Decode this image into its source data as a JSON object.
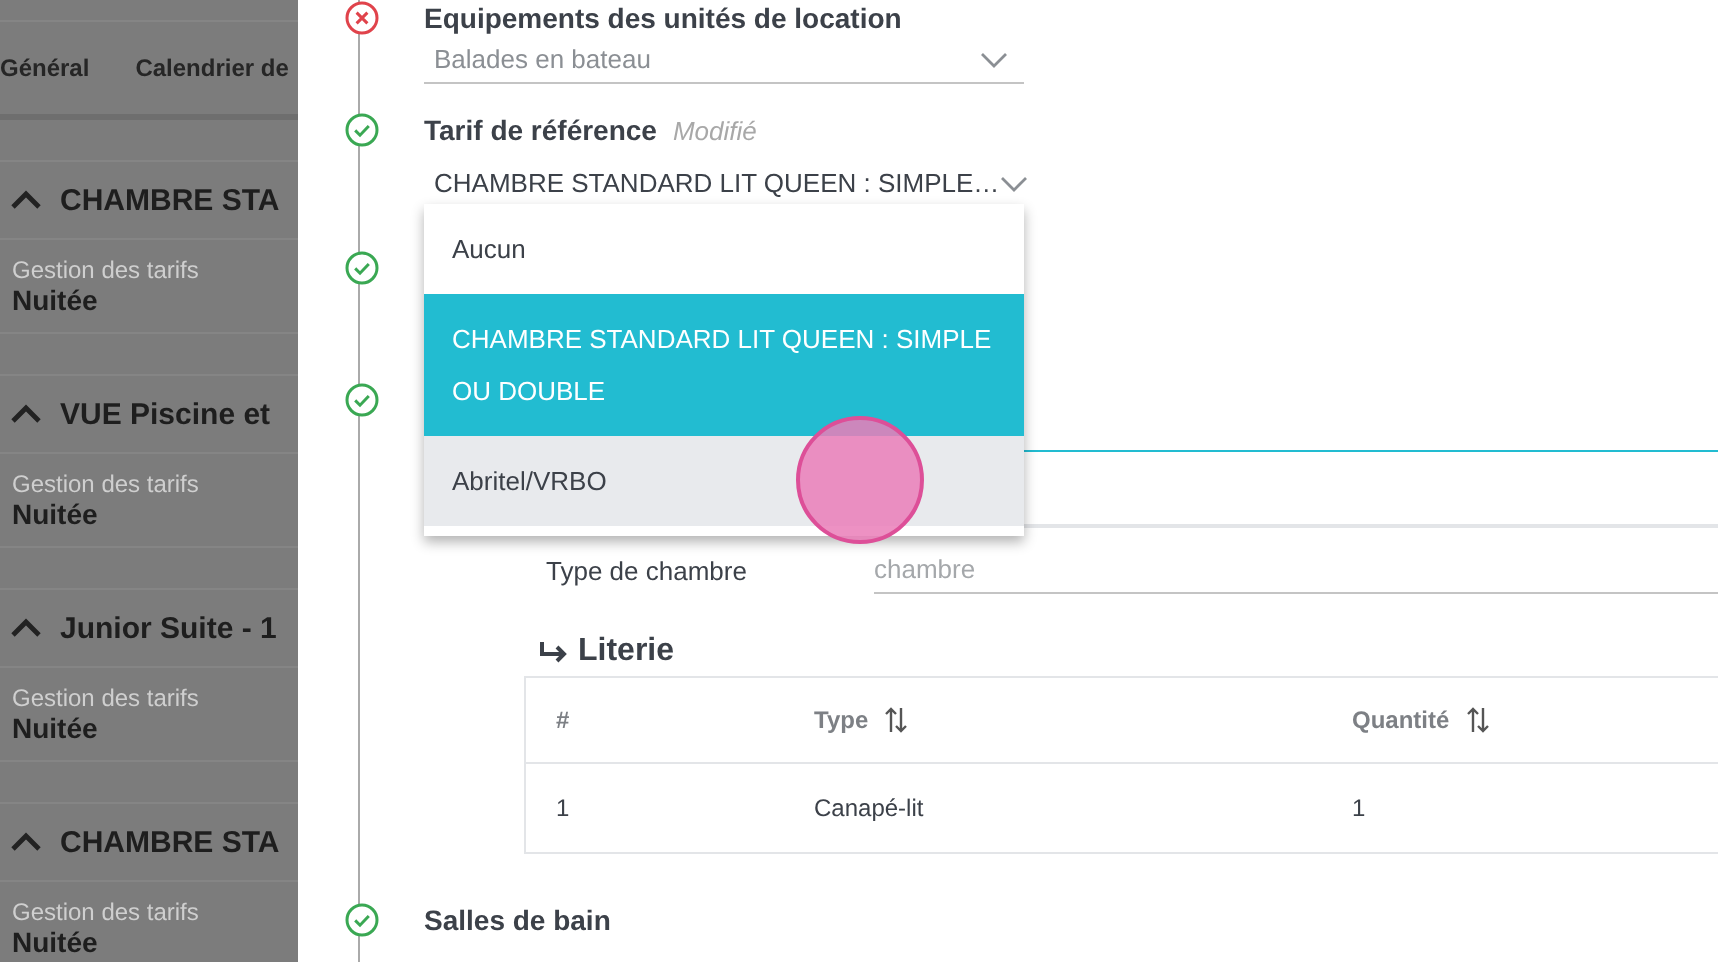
{
  "background_page": {
    "tabs": [
      {
        "label": "Général"
      },
      {
        "label": "Calendrier de"
      }
    ],
    "sections": [
      {
        "title": "CHAMBRE STA",
        "expanded": true,
        "label": "Gestion des tarifs",
        "value": "Nuitée"
      },
      {
        "title": "VUE Piscine et",
        "expanded": true,
        "label": "Gestion des tarifs",
        "value": "Nuitée"
      },
      {
        "title": "Junior Suite - 1",
        "expanded": true,
        "label": "Gestion des tarifs",
        "value": "Nuitée"
      },
      {
        "title": "CHAMBRE STA",
        "expanded": true,
        "label": "Gestion des tarifs",
        "value": "Nuitée"
      }
    ]
  },
  "panel": {
    "steps": [
      {
        "kind": "select",
        "valid": false,
        "label": "Equipements des unités de location",
        "value": "Balades en bateau",
        "open": false
      },
      {
        "kind": "select",
        "valid": true,
        "label": "Tarif de référence",
        "note": "Modifié",
        "value": "CHAMBRE STANDARD LIT QUEEN : SIMPLE…",
        "open": true,
        "options": [
          {
            "label": "Aucun",
            "selected": false,
            "hovered": false
          },
          {
            "label": "CHAMBRE STANDARD LIT QUEEN : SIMPLE OU DOUBLE",
            "selected": true,
            "hovered": false
          },
          {
            "label": "Abritel/VRBO",
            "selected": false,
            "hovered": true
          }
        ]
      },
      {
        "kind": "hidden",
        "valid": true
      },
      {
        "kind": "tabs",
        "valid": true
      },
      {
        "kind": "heading",
        "valid": true,
        "label": "Salles de bain"
      }
    ],
    "tab_panel": {
      "room_type": {
        "label": "Type de chambre",
        "placeholder": "chambre"
      },
      "bedding": {
        "title": "Literie",
        "columns": [
          {
            "label": "#",
            "sortable": false
          },
          {
            "label": "Type",
            "sortable": true
          },
          {
            "label": "Quantité",
            "sortable": true
          }
        ],
        "rows": [
          [
            "1",
            "Canapé-lit",
            "1"
          ]
        ]
      }
    }
  }
}
